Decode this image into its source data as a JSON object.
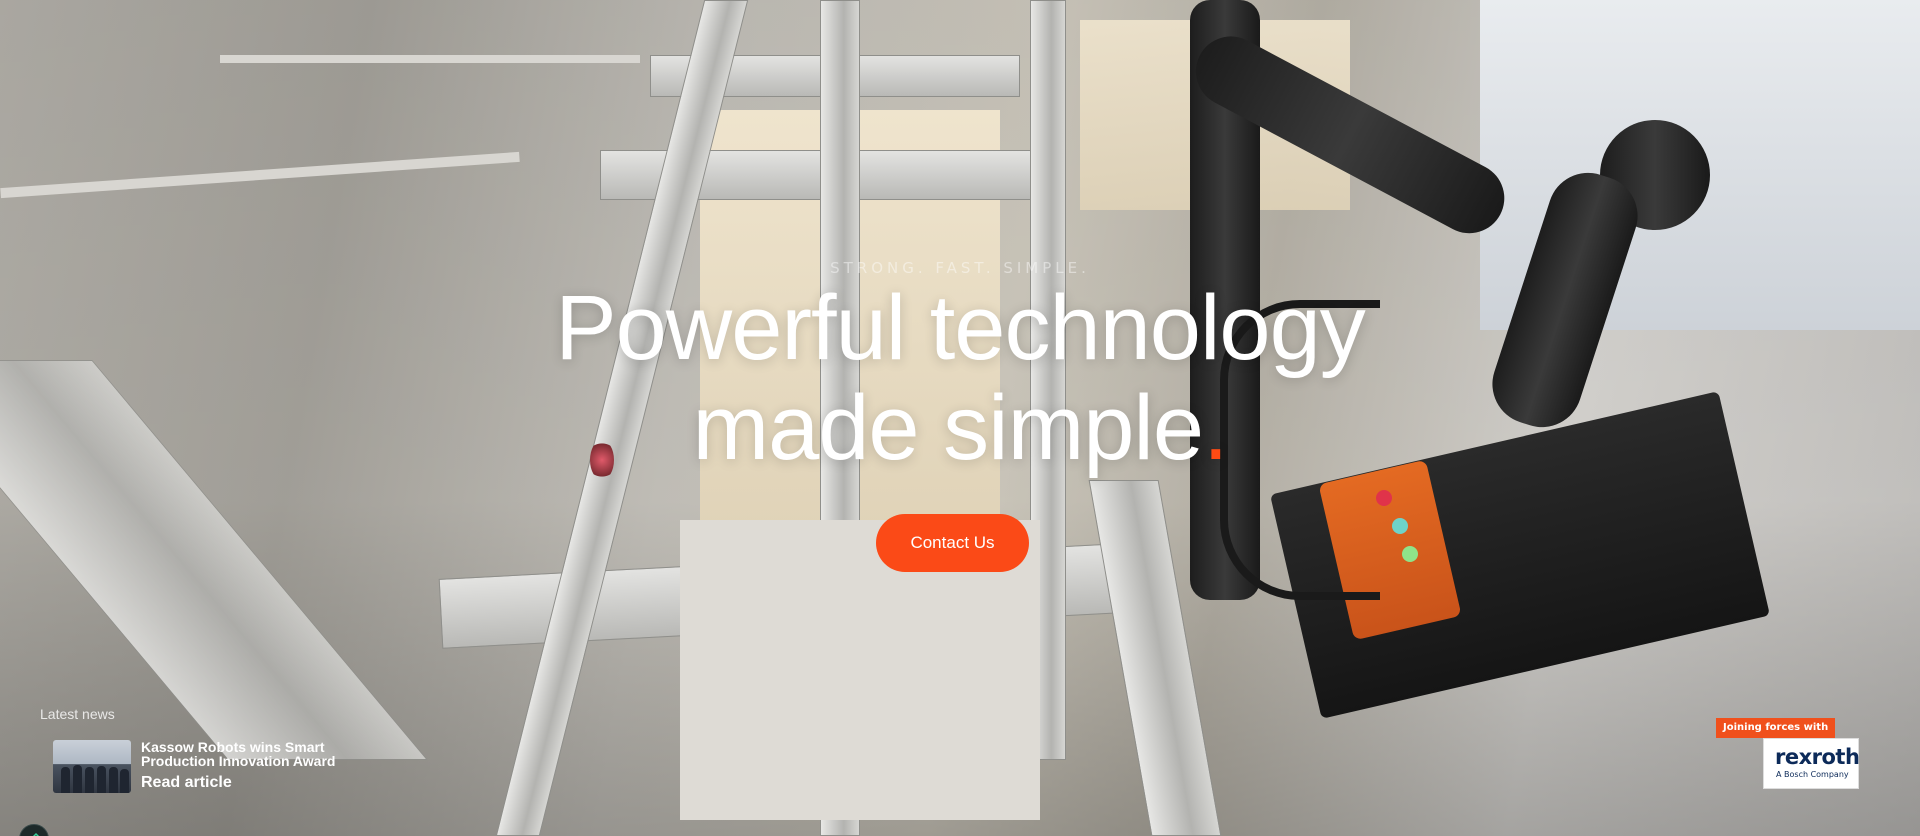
{
  "hero": {
    "tagline": "STRONG. FAST. SIMPLE.",
    "headline_line1": "Powerful technology",
    "headline_line2": "made simple",
    "headline_dot": ".",
    "cta_label": "Contact Us",
    "accent_color": "#fb4a17"
  },
  "news": {
    "section_label": "Latest news",
    "title": "Kassow Robots wins Smart Production Innovation Award",
    "link_label": "Read article"
  },
  "partner": {
    "badge": "Joining forces with",
    "logo_text": "rexroth",
    "logo_subtext": "A Bosch Company"
  },
  "icons": {
    "chat": "edit-icon"
  }
}
